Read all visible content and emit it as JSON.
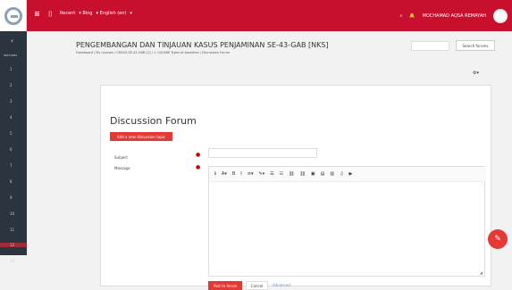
{
  "topbar": {
    "nav": [
      "Recent",
      "Blog",
      "English (en)"
    ],
    "user_name": "MOCHAMAD AQSA REMAYAH"
  },
  "sidebar": {
    "label": "SECTIONS",
    "items": [
      "1",
      "2",
      "3",
      "4",
      "5",
      "6",
      "7",
      "8",
      "9",
      "10",
      "11",
      "12",
      "13"
    ]
  },
  "header": {
    "title": "PENGEMBANGAN DAN TINJAUAN KASUS PENJAMINAN SE-43-GAB [NKS]",
    "breadcrumb": "Dashboard / My courses / CR443-SE-43-GAB [1] / 1: 04C486 Types of Assertion / Discussion Forum",
    "search_placeholder": "",
    "search_button": "Search forums"
  },
  "forum": {
    "title": "Discussion Forum",
    "add_button": "Add a new discussion topic",
    "subject_label": "Subject",
    "message_label": "Message",
    "submit": "Post to forum",
    "cancel": "Cancel",
    "advanced": "Advanced"
  },
  "icons": {
    "hamburger": "menu-icon",
    "search": "search-icon",
    "bell": "bell-icon",
    "gear": "gear-icon",
    "fab": "edit-icon"
  },
  "colors": {
    "brand": "#c8102e",
    "primary_button": "#e53935",
    "sidebar": "#2b3540"
  }
}
